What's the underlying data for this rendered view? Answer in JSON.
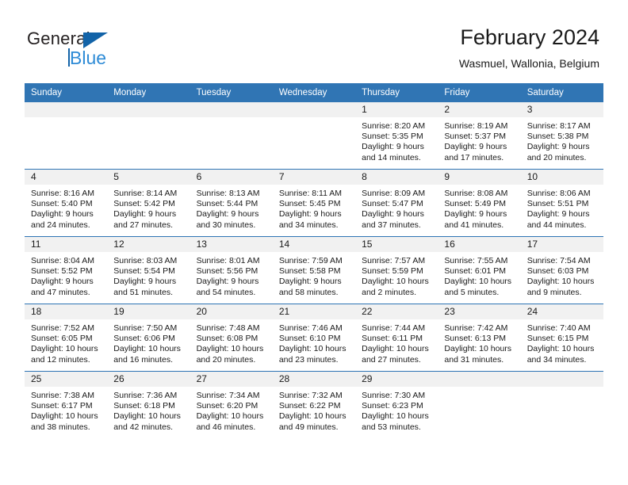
{
  "brand": {
    "name_part1": "General",
    "name_part2": "Blue"
  },
  "header": {
    "title": "February 2024",
    "subtitle": "Wasmuel, Wallonia, Belgium"
  },
  "colors": {
    "header_blue": "#3075b4",
    "row_divider_blue": "#2e74b5",
    "daynum_band_gray": "#f1f1f1",
    "brand_blue_dark": "#1263a8",
    "brand_blue_light": "#2e8bd6"
  },
  "weekday_headers": [
    "Sunday",
    "Monday",
    "Tuesday",
    "Wednesday",
    "Thursday",
    "Friday",
    "Saturday"
  ],
  "weeks": [
    [
      {
        "day": "",
        "sunrise": "",
        "sunset": "",
        "daylight_line1": "",
        "daylight_line2": ""
      },
      {
        "day": "",
        "sunrise": "",
        "sunset": "",
        "daylight_line1": "",
        "daylight_line2": ""
      },
      {
        "day": "",
        "sunrise": "",
        "sunset": "",
        "daylight_line1": "",
        "daylight_line2": ""
      },
      {
        "day": "",
        "sunrise": "",
        "sunset": "",
        "daylight_line1": "",
        "daylight_line2": ""
      },
      {
        "day": "1",
        "sunrise": "Sunrise: 8:20 AM",
        "sunset": "Sunset: 5:35 PM",
        "daylight_line1": "Daylight: 9 hours",
        "daylight_line2": "and 14 minutes."
      },
      {
        "day": "2",
        "sunrise": "Sunrise: 8:19 AM",
        "sunset": "Sunset: 5:37 PM",
        "daylight_line1": "Daylight: 9 hours",
        "daylight_line2": "and 17 minutes."
      },
      {
        "day": "3",
        "sunrise": "Sunrise: 8:17 AM",
        "sunset": "Sunset: 5:38 PM",
        "daylight_line1": "Daylight: 9 hours",
        "daylight_line2": "and 20 minutes."
      }
    ],
    [
      {
        "day": "4",
        "sunrise": "Sunrise: 8:16 AM",
        "sunset": "Sunset: 5:40 PM",
        "daylight_line1": "Daylight: 9 hours",
        "daylight_line2": "and 24 minutes."
      },
      {
        "day": "5",
        "sunrise": "Sunrise: 8:14 AM",
        "sunset": "Sunset: 5:42 PM",
        "daylight_line1": "Daylight: 9 hours",
        "daylight_line2": "and 27 minutes."
      },
      {
        "day": "6",
        "sunrise": "Sunrise: 8:13 AM",
        "sunset": "Sunset: 5:44 PM",
        "daylight_line1": "Daylight: 9 hours",
        "daylight_line2": "and 30 minutes."
      },
      {
        "day": "7",
        "sunrise": "Sunrise: 8:11 AM",
        "sunset": "Sunset: 5:45 PM",
        "daylight_line1": "Daylight: 9 hours",
        "daylight_line2": "and 34 minutes."
      },
      {
        "day": "8",
        "sunrise": "Sunrise: 8:09 AM",
        "sunset": "Sunset: 5:47 PM",
        "daylight_line1": "Daylight: 9 hours",
        "daylight_line2": "and 37 minutes."
      },
      {
        "day": "9",
        "sunrise": "Sunrise: 8:08 AM",
        "sunset": "Sunset: 5:49 PM",
        "daylight_line1": "Daylight: 9 hours",
        "daylight_line2": "and 41 minutes."
      },
      {
        "day": "10",
        "sunrise": "Sunrise: 8:06 AM",
        "sunset": "Sunset: 5:51 PM",
        "daylight_line1": "Daylight: 9 hours",
        "daylight_line2": "and 44 minutes."
      }
    ],
    [
      {
        "day": "11",
        "sunrise": "Sunrise: 8:04 AM",
        "sunset": "Sunset: 5:52 PM",
        "daylight_line1": "Daylight: 9 hours",
        "daylight_line2": "and 47 minutes."
      },
      {
        "day": "12",
        "sunrise": "Sunrise: 8:03 AM",
        "sunset": "Sunset: 5:54 PM",
        "daylight_line1": "Daylight: 9 hours",
        "daylight_line2": "and 51 minutes."
      },
      {
        "day": "13",
        "sunrise": "Sunrise: 8:01 AM",
        "sunset": "Sunset: 5:56 PM",
        "daylight_line1": "Daylight: 9 hours",
        "daylight_line2": "and 54 minutes."
      },
      {
        "day": "14",
        "sunrise": "Sunrise: 7:59 AM",
        "sunset": "Sunset: 5:58 PM",
        "daylight_line1": "Daylight: 9 hours",
        "daylight_line2": "and 58 minutes."
      },
      {
        "day": "15",
        "sunrise": "Sunrise: 7:57 AM",
        "sunset": "Sunset: 5:59 PM",
        "daylight_line1": "Daylight: 10 hours",
        "daylight_line2": "and 2 minutes."
      },
      {
        "day": "16",
        "sunrise": "Sunrise: 7:55 AM",
        "sunset": "Sunset: 6:01 PM",
        "daylight_line1": "Daylight: 10 hours",
        "daylight_line2": "and 5 minutes."
      },
      {
        "day": "17",
        "sunrise": "Sunrise: 7:54 AM",
        "sunset": "Sunset: 6:03 PM",
        "daylight_line1": "Daylight: 10 hours",
        "daylight_line2": "and 9 minutes."
      }
    ],
    [
      {
        "day": "18",
        "sunrise": "Sunrise: 7:52 AM",
        "sunset": "Sunset: 6:05 PM",
        "daylight_line1": "Daylight: 10 hours",
        "daylight_line2": "and 12 minutes."
      },
      {
        "day": "19",
        "sunrise": "Sunrise: 7:50 AM",
        "sunset": "Sunset: 6:06 PM",
        "daylight_line1": "Daylight: 10 hours",
        "daylight_line2": "and 16 minutes."
      },
      {
        "day": "20",
        "sunrise": "Sunrise: 7:48 AM",
        "sunset": "Sunset: 6:08 PM",
        "daylight_line1": "Daylight: 10 hours",
        "daylight_line2": "and 20 minutes."
      },
      {
        "day": "21",
        "sunrise": "Sunrise: 7:46 AM",
        "sunset": "Sunset: 6:10 PM",
        "daylight_line1": "Daylight: 10 hours",
        "daylight_line2": "and 23 minutes."
      },
      {
        "day": "22",
        "sunrise": "Sunrise: 7:44 AM",
        "sunset": "Sunset: 6:11 PM",
        "daylight_line1": "Daylight: 10 hours",
        "daylight_line2": "and 27 minutes."
      },
      {
        "day": "23",
        "sunrise": "Sunrise: 7:42 AM",
        "sunset": "Sunset: 6:13 PM",
        "daylight_line1": "Daylight: 10 hours",
        "daylight_line2": "and 31 minutes."
      },
      {
        "day": "24",
        "sunrise": "Sunrise: 7:40 AM",
        "sunset": "Sunset: 6:15 PM",
        "daylight_line1": "Daylight: 10 hours",
        "daylight_line2": "and 34 minutes."
      }
    ],
    [
      {
        "day": "25",
        "sunrise": "Sunrise: 7:38 AM",
        "sunset": "Sunset: 6:17 PM",
        "daylight_line1": "Daylight: 10 hours",
        "daylight_line2": "and 38 minutes."
      },
      {
        "day": "26",
        "sunrise": "Sunrise: 7:36 AM",
        "sunset": "Sunset: 6:18 PM",
        "daylight_line1": "Daylight: 10 hours",
        "daylight_line2": "and 42 minutes."
      },
      {
        "day": "27",
        "sunrise": "Sunrise: 7:34 AM",
        "sunset": "Sunset: 6:20 PM",
        "daylight_line1": "Daylight: 10 hours",
        "daylight_line2": "and 46 minutes."
      },
      {
        "day": "28",
        "sunrise": "Sunrise: 7:32 AM",
        "sunset": "Sunset: 6:22 PM",
        "daylight_line1": "Daylight: 10 hours",
        "daylight_line2": "and 49 minutes."
      },
      {
        "day": "29",
        "sunrise": "Sunrise: 7:30 AM",
        "sunset": "Sunset: 6:23 PM",
        "daylight_line1": "Daylight: 10 hours",
        "daylight_line2": "and 53 minutes."
      },
      {
        "day": "",
        "sunrise": "",
        "sunset": "",
        "daylight_line1": "",
        "daylight_line2": ""
      },
      {
        "day": "",
        "sunrise": "",
        "sunset": "",
        "daylight_line1": "",
        "daylight_line2": ""
      }
    ]
  ]
}
